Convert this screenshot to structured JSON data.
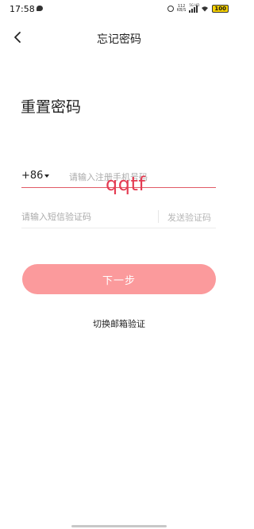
{
  "status_bar": {
    "time": "17:58",
    "net_speed_value": "112",
    "net_speed_unit": "KB/S",
    "network_label": "5G HD",
    "battery": "100"
  },
  "nav": {
    "title": "忘记密码"
  },
  "page": {
    "title": "重置密码"
  },
  "phone": {
    "country_code": "+86",
    "placeholder": "请输入注册手机号码",
    "typed_value": "qqtf"
  },
  "sms": {
    "placeholder": "请输入短信验证码",
    "send_code_label": "发送验证码"
  },
  "actions": {
    "next_label": "下一步",
    "switch_email_label": "切换邮箱验证"
  },
  "colors": {
    "primary_button": "#fb9a9c",
    "active_underline": "#e05a66",
    "typed_text": "#e43b52"
  }
}
